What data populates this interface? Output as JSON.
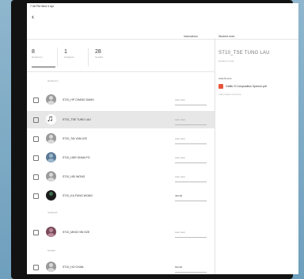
{
  "statusbar": {
    "text": "7:38 PM  Wed 9 Apr"
  },
  "header": {
    "back_icon": "arrow-back-icon",
    "returned_label": "Instructions",
    "submission_label": "Student work"
  },
  "stats": [
    {
      "num": "8",
      "label": "Handed in"
    },
    {
      "num": "1",
      "label": "Assigned"
    },
    {
      "num": "28",
      "label": "Graded"
    }
  ],
  "sections": {
    "handed_in": "Handed in",
    "assigned": "Assigned",
    "graded": "Graded"
  },
  "students": [
    {
      "name": "ST10_HP CHANG DANH",
      "grade": "Add mark"
    },
    {
      "name": "ST10_TSE TUNG LAU",
      "grade": "Add mark",
      "selected": true
    },
    {
      "name": "ST10_TAI YAN LEE",
      "grade": "Add mark"
    },
    {
      "name": "ST10_HER SHAN PO",
      "grade": "Add mark"
    },
    {
      "name": "ST10_HEI WONG",
      "grade": "Add mark"
    },
    {
      "name": "ST10_KA FUNG WONG",
      "grade": "39/100",
      "graded": true
    },
    {
      "name": "ST10_MING HIN SZE",
      "grade": "Add mark"
    },
    {
      "name": "ST10_HO CHAN",
      "grade": "50/100",
      "graded": true
    }
  ],
  "panel": {
    "title": "ST10_TSE TUNG LAU",
    "status": "Handed in late",
    "attachments_label": "Attachments",
    "file_icon": "pdf-file-icon",
    "file_name": "Gaffer 5 Composition Speech.pdf",
    "note": "Add private comment"
  }
}
